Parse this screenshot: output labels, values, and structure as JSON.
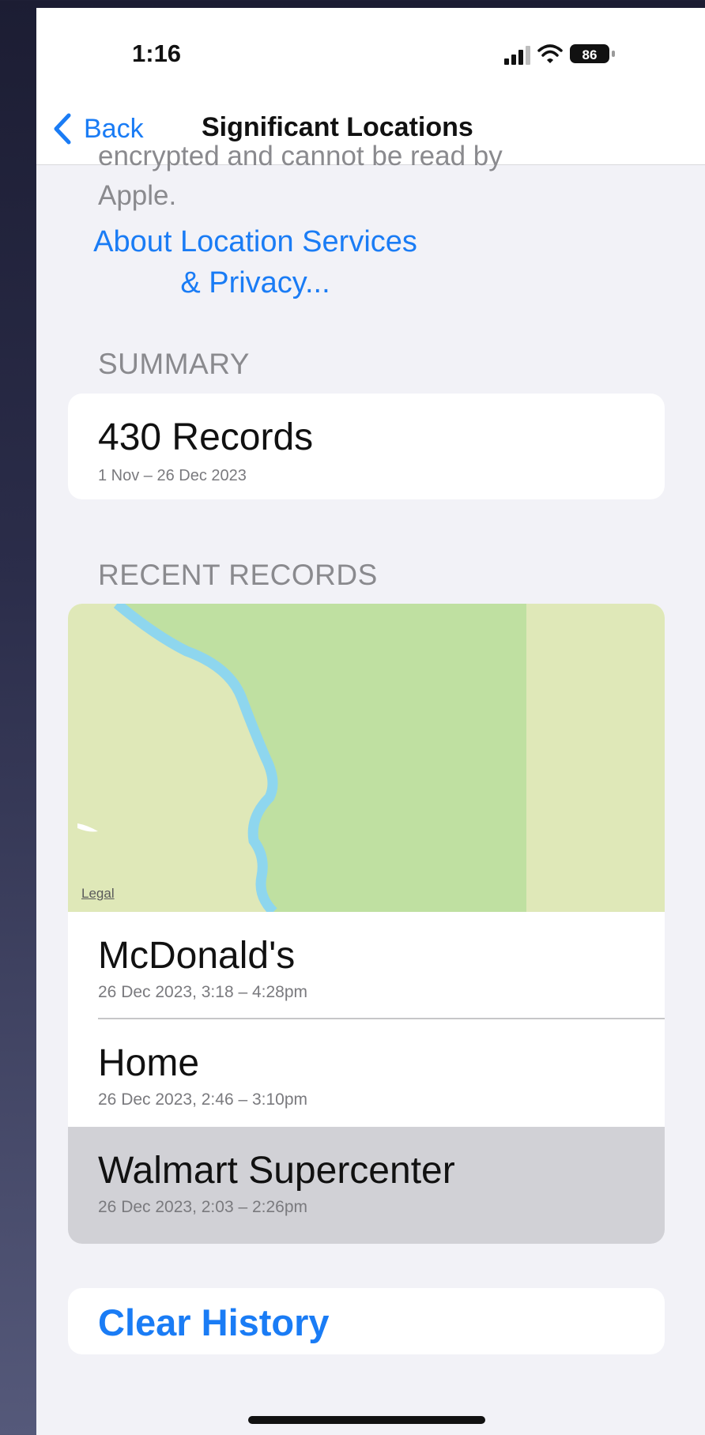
{
  "status_bar": {
    "time": "1:16",
    "battery_level": "86"
  },
  "nav": {
    "back_label": "Back",
    "title": "Significant Locations"
  },
  "intro": {
    "clipped_text": "encrypted and cannot be read by",
    "apple_text": "Apple.",
    "about_link": "About Location Services & Privacy..."
  },
  "summary": {
    "header": "SUMMARY",
    "count_label": "430 Records",
    "range": "1 Nov – 26 Dec 2023"
  },
  "recent": {
    "header": "RECENT RECORDS",
    "map_legal": "Legal",
    "records": [
      {
        "name": "McDonald's",
        "time": "26 Dec 2023, 3:18 – 4:28pm"
      },
      {
        "name": "Home",
        "time": "26 Dec 2023, 2:46 – 3:10pm"
      },
      {
        "name": "Walmart Supercenter",
        "time": "26 Dec 2023, 2:03 – 2:26pm"
      }
    ]
  },
  "actions": {
    "clear_history": "Clear History"
  },
  "colors": {
    "accent": "#1a7cf5",
    "map_park": "#bfe0a1",
    "map_land": "#dfe8b8",
    "map_water": "#8ed6ee",
    "selected_row": "#d1d1d6"
  }
}
